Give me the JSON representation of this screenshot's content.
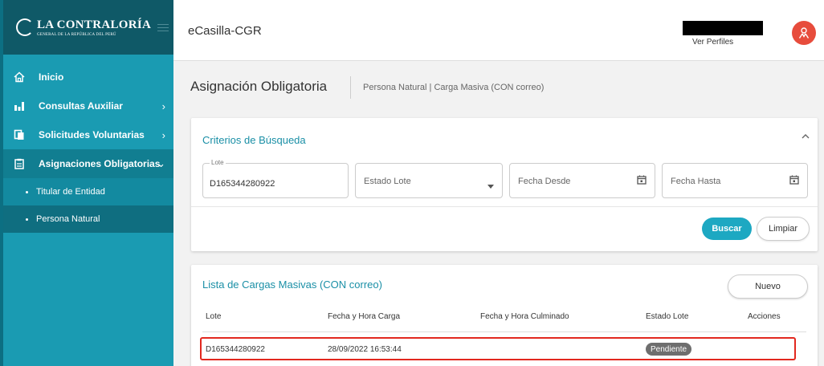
{
  "brand": {
    "logo_main": "LA CONTRALORÍA",
    "logo_sub": "GENERAL DE LA REPÚBLICA DEL PERÚ"
  },
  "header": {
    "app_title": "eCasilla-CGR",
    "profile_link": "Ver Perfiles"
  },
  "sidebar": {
    "items": [
      {
        "label": "Inicio",
        "icon": "home-icon"
      },
      {
        "label": "Consultas Auxiliar",
        "icon": "bar-chart-icon"
      },
      {
        "label": "Solicitudes Voluntarias",
        "icon": "copy-icon"
      },
      {
        "label": "Asignaciones Obligatorias",
        "icon": "clipboard-icon"
      }
    ],
    "subitems": [
      {
        "label": "Titular de Entidad"
      },
      {
        "label": "Persona Natural"
      }
    ]
  },
  "page": {
    "title": "Asignación Obligatoria",
    "subtitle": "Persona Natural | Carga Masiva (CON correo)"
  },
  "search": {
    "title": "Criterios de Búsqueda",
    "lote_label": "Lote",
    "lote_value": "D165344280922",
    "estado_placeholder": "Estado Lote",
    "fecha_desde_placeholder": "Fecha Desde",
    "fecha_hasta_placeholder": "Fecha Hasta",
    "buscar_label": "Buscar",
    "limpiar_label": "Limpiar"
  },
  "list": {
    "title": "Lista de Cargas Masivas (CON correo)",
    "nuevo_label": "Nuevo",
    "columns": [
      "Lote",
      "Fecha y Hora Carga",
      "Fecha y Hora Culminado",
      "Estado Lote",
      "Acciones"
    ],
    "rows": [
      {
        "lote": "D165344280922",
        "fecha_carga": "28/09/2022 16:53:44",
        "fecha_culminado": "",
        "estado": "Pendiente"
      }
    ]
  },
  "colors": {
    "sidebar": "#1a9bb2",
    "accent": "#1da8c2",
    "avatar": "#e74c3c",
    "highlight": "#e2281f"
  }
}
